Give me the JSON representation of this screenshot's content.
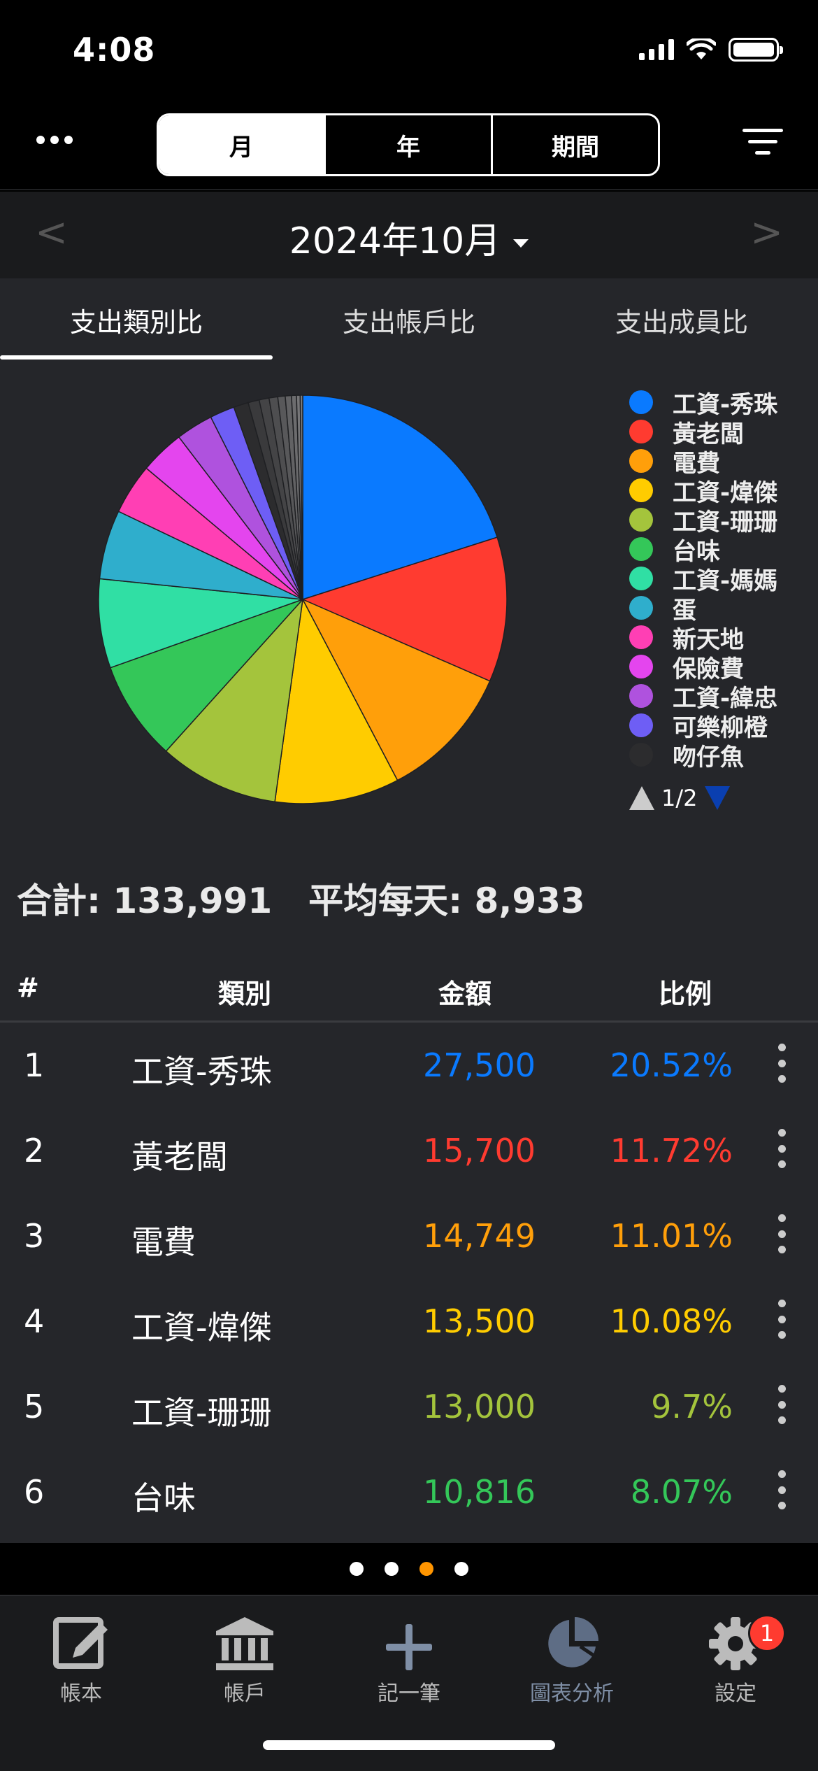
{
  "status": {
    "time": "4:08"
  },
  "nav": {
    "segments": [
      "月",
      "年",
      "期間"
    ],
    "active_segment": 0
  },
  "month": {
    "title": "2024年10月",
    "prev": "<",
    "next": ">"
  },
  "tabs": [
    "支出類別比",
    "支出帳戶比",
    "支出成員比"
  ],
  "legend": {
    "items": [
      {
        "label": "工資-秀珠",
        "color": "#0a7aff"
      },
      {
        "label": "黃老闆",
        "color": "#ff3b30"
      },
      {
        "label": "電費",
        "color": "#ff9f0a"
      },
      {
        "label": "工資-煒傑",
        "color": "#ffcc00"
      },
      {
        "label": "工資-珊珊",
        "color": "#a4c43c"
      },
      {
        "label": "台味",
        "color": "#34c759"
      },
      {
        "label": "工資-媽媽",
        "color": "#30dfa4"
      },
      {
        "label": "蛋",
        "color": "#2faecc"
      },
      {
        "label": "新天地",
        "color": "#ff3fb4"
      },
      {
        "label": "保險費",
        "color": "#e445ee"
      },
      {
        "label": "工資-緯忠",
        "color": "#af52de"
      },
      {
        "label": "可樂柳橙",
        "color": "#6e5ef5"
      },
      {
        "label": "吻仔魚",
        "color": "#2c2c2e"
      }
    ],
    "page": "1/2"
  },
  "chart_data": {
    "type": "pie",
    "categories": [
      "工資-秀珠",
      "黃老闆",
      "電費",
      "工資-煒傑",
      "工資-珊珊",
      "台味",
      "工資-媽媽",
      "蛋",
      "新天地",
      "保險費",
      "工資-緯忠",
      "可樂柳橙",
      "吻仔魚"
    ],
    "values": [
      20.52,
      11.72,
      11.01,
      10.08,
      9.7,
      8.07,
      7.2,
      5.6,
      4.1,
      3.6,
      3.0,
      2.0,
      1.2
    ],
    "extra_small_slices_percent": [
      0.9,
      0.8,
      0.7,
      0.6,
      0.5,
      0.4,
      0.3,
      0.2
    ],
    "colors": [
      "#0a7aff",
      "#ff3b30",
      "#ff9f0a",
      "#ffcc00",
      "#a4c43c",
      "#34c759",
      "#30dfa4",
      "#2faecc",
      "#ff3fb4",
      "#e445ee",
      "#af52de",
      "#6e5ef5",
      "#2c2c2e"
    ],
    "extra_colors": [
      "#3a3a3c",
      "#444446",
      "#4e4e50",
      "#58585a",
      "#626264",
      "#6c6c6e",
      "#767678",
      "#808082"
    ]
  },
  "totals": {
    "total": "合計: 133,991",
    "daily_avg": "平均每天: 8,933"
  },
  "table": {
    "headers": {
      "num": "#",
      "category": "類別",
      "amount": "金額",
      "ratio": "比例"
    },
    "rows": [
      {
        "idx": "1",
        "name": "工資-秀珠",
        "amount": "27,500",
        "ratio": "20.52%",
        "color": "#0a7aff"
      },
      {
        "idx": "2",
        "name": "黃老闆",
        "amount": "15,700",
        "ratio": "11.72%",
        "color": "#ff3b30"
      },
      {
        "idx": "3",
        "name": "電費",
        "amount": "14,749",
        "ratio": "11.01%",
        "color": "#ff9f0a"
      },
      {
        "idx": "4",
        "name": "工資-煒傑",
        "amount": "13,500",
        "ratio": "10.08%",
        "color": "#ffcc00"
      },
      {
        "idx": "5",
        "name": "工資-珊珊",
        "amount": "13,000",
        "ratio": "9.7%",
        "color": "#a4c43c"
      },
      {
        "idx": "6",
        "name": "台味",
        "amount": "10,816",
        "ratio": "8.07%",
        "color": "#34c759"
      }
    ]
  },
  "tabbar": {
    "items": [
      {
        "label": "帳本",
        "icon": "ledger-edit-icon"
      },
      {
        "label": "帳戶",
        "icon": "bank-icon"
      },
      {
        "label": "記一筆",
        "icon": "plus-icon"
      },
      {
        "label": "圖表分析",
        "icon": "pie-chart-icon"
      },
      {
        "label": "設定",
        "icon": "gear-icon"
      }
    ],
    "active": 3,
    "settings_badge": "1"
  }
}
